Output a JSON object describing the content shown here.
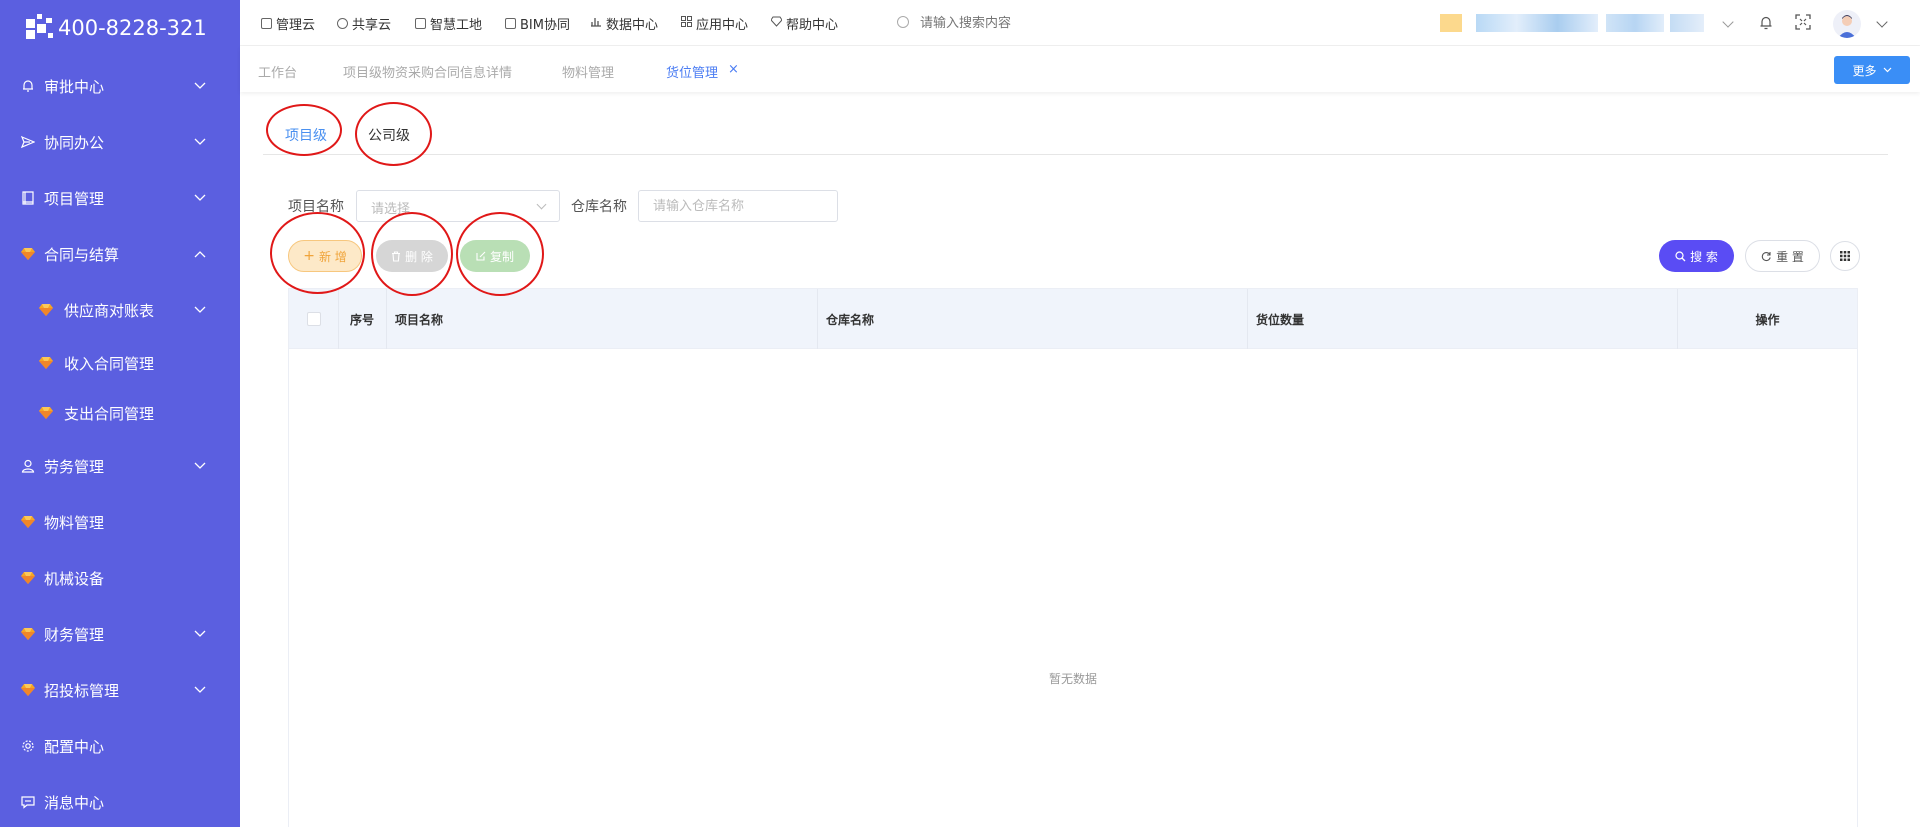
{
  "app": {
    "logo_text": "400-8228-321"
  },
  "sidebar": {
    "items": [
      {
        "label": "审批中心",
        "icon": "bell-icon",
        "expandable": true,
        "expanded": false
      },
      {
        "label": "协同办公",
        "icon": "send-icon",
        "expandable": true,
        "expanded": false
      },
      {
        "label": "项目管理",
        "icon": "book-icon",
        "expandable": true,
        "expanded": false
      },
      {
        "label": "合同与结算",
        "icon": "gem-icon",
        "expandable": true,
        "expanded": true
      },
      {
        "label": "供应商对账表",
        "icon": "gem-icon",
        "expandable": true,
        "expanded": false,
        "sub": true
      },
      {
        "label": "收入合同管理",
        "icon": "gem-icon",
        "expandable": false,
        "sub": true
      },
      {
        "label": "支出合同管理",
        "icon": "gem-icon",
        "expandable": false,
        "sub": true
      },
      {
        "label": "劳务管理",
        "icon": "user-icon",
        "expandable": true,
        "expanded": false
      },
      {
        "label": "物料管理",
        "icon": "gem-icon",
        "expandable": false
      },
      {
        "label": "机械设备",
        "icon": "gem-icon",
        "expandable": false
      },
      {
        "label": "财务管理",
        "icon": "gem-icon",
        "expandable": true,
        "expanded": false
      },
      {
        "label": "招投标管理",
        "icon": "gem-icon",
        "expandable": true,
        "expanded": false
      },
      {
        "label": "配置中心",
        "icon": "gear-icon",
        "expandable": false
      },
      {
        "label": "消息中心",
        "icon": "message-icon",
        "expandable": false
      }
    ]
  },
  "topbar": {
    "nav": [
      "管理云",
      "共享云",
      "智慧工地",
      "BIM协同",
      "数据中心",
      "应用中心",
      "帮助中心"
    ],
    "search_placeholder": "请输入搜索内容"
  },
  "tabs": {
    "items": [
      "工作台",
      "项目级物资采购合同信息详情",
      "物料管理",
      "货位管理"
    ],
    "active": "货位管理",
    "close_symbol": "×",
    "more_label": "更多"
  },
  "content": {
    "level_tabs": [
      "项目级",
      "公司级"
    ],
    "active_level_tab": "项目级",
    "filters": {
      "project_label": "项目名称",
      "project_placeholder": "请选择",
      "warehouse_label": "仓库名称",
      "warehouse_placeholder": "请输入仓库名称"
    },
    "buttons": {
      "add": "新 增",
      "delete": "删 除",
      "copy": "复制",
      "search": "搜 索",
      "reset": "重 置"
    },
    "table": {
      "columns": [
        "序号",
        "项目名称",
        "仓库名称",
        "货位数量",
        "操作"
      ],
      "rows": [],
      "empty_text": "暂无数据"
    }
  },
  "colors": {
    "sidebar_bg": "#5b5fe0",
    "accent_blue": "#4a7cf3",
    "search_button": "#5a4cf4",
    "annotation_red": "#e01818"
  }
}
